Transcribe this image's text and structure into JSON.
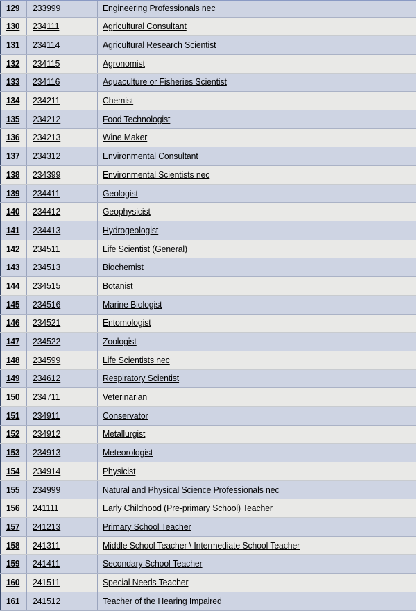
{
  "table": {
    "name": "occupation-code-list",
    "columns": [
      "index",
      "code",
      "title"
    ],
    "colors": {
      "row_odd_bg": "#ced4e3",
      "row_even_bg": "#e9e9e7",
      "grid_line": "#aab2c6",
      "text": "#000000",
      "top_rule": "#8a9ac4",
      "page_bg": "#ffffff"
    },
    "rows": [
      {
        "index": "129",
        "code": "233999",
        "title": "Engineering Professionals nec"
      },
      {
        "index": "130",
        "code": "234111",
        "title": "Agricultural Consultant"
      },
      {
        "index": "131",
        "code": "234114",
        "title": "Agricultural Research Scientist"
      },
      {
        "index": "132",
        "code": "234115",
        "title": "Agronomist"
      },
      {
        "index": "133",
        "code": "234116",
        "title": "Aquaculture or Fisheries Scientist"
      },
      {
        "index": "134",
        "code": "234211",
        "title": "Chemist"
      },
      {
        "index": "135",
        "code": "234212",
        "title": "Food Technologist"
      },
      {
        "index": "136",
        "code": "234213",
        "title": "Wine Maker"
      },
      {
        "index": "137",
        "code": "234312",
        "title": "Environmental Consultant"
      },
      {
        "index": "138",
        "code": "234399",
        "title": "Environmental Scientists nec"
      },
      {
        "index": "139",
        "code": "234411",
        "title": "Geologist"
      },
      {
        "index": "140",
        "code": "234412",
        "title": "Geophysicist"
      },
      {
        "index": "141",
        "code": "234413",
        "title": "Hydrogeologist"
      },
      {
        "index": "142",
        "code": "234511",
        "title": "Life Scientist (General)"
      },
      {
        "index": "143",
        "code": "234513",
        "title": "Biochemist"
      },
      {
        "index": "144",
        "code": "234515",
        "title": "Botanist"
      },
      {
        "index": "145",
        "code": "234516",
        "title": "Marine Biologist"
      },
      {
        "index": "146",
        "code": "234521",
        "title": "Entomologist"
      },
      {
        "index": "147",
        "code": "234522",
        "title": "Zoologist"
      },
      {
        "index": "148",
        "code": "234599",
        "title": "Life Scientists nec"
      },
      {
        "index": "149",
        "code": "234612",
        "title": "Respiratory Scientist"
      },
      {
        "index": "150",
        "code": "234711",
        "title": "Veterinarian"
      },
      {
        "index": "151",
        "code": "234911",
        "title": "Conservator"
      },
      {
        "index": "152",
        "code": "234912",
        "title": "Metallurgist"
      },
      {
        "index": "153",
        "code": "234913",
        "title": "Meteorologist"
      },
      {
        "index": "154",
        "code": "234914",
        "title": "Physicist"
      },
      {
        "index": "155",
        "code": "234999",
        "title": "Natural and Physical Science Professionals nec"
      },
      {
        "index": "156",
        "code": "241111",
        "title": "Early Childhood (Pre-primary School) Teacher"
      },
      {
        "index": "157",
        "code": "241213",
        "title": "Primary School Teacher"
      },
      {
        "index": "158",
        "code": "241311",
        "title": "Middle School Teacher \\ Intermediate School Teacher"
      },
      {
        "index": "159",
        "code": "241411",
        "title": "Secondary School Teacher"
      },
      {
        "index": "160",
        "code": "241511",
        "title": "Special Needs Teacher"
      },
      {
        "index": "161",
        "code": "241512",
        "title": "Teacher of the Hearing Impaired"
      }
    ]
  }
}
